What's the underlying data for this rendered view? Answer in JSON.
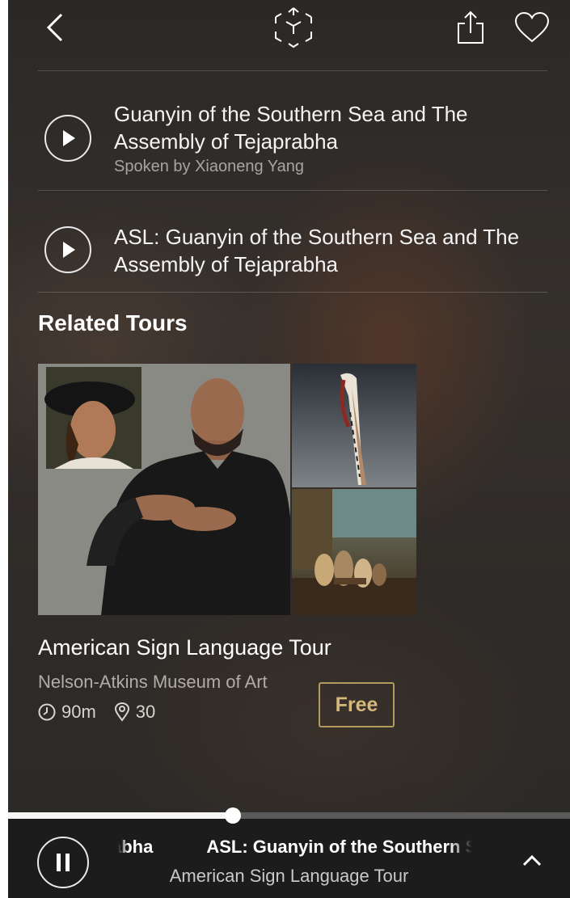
{
  "topbar": {
    "back_icon": "chevron-left-icon",
    "ar_icon": "ar-cube-icon",
    "share_icon": "share-icon",
    "favorite_icon": "heart-icon"
  },
  "tracks": [
    {
      "title": "Guanyin of the Southern Sea and The Assembly of Tejaprabha",
      "subtitle": "Spoken by Xiaoneng Yang",
      "icon": "play-icon"
    },
    {
      "title": "ASL: Guanyin of the Southern Sea and The Assembly of Tejaprabha",
      "icon": "play-icon"
    }
  ],
  "related": {
    "heading": "Related Tours",
    "tour": {
      "title": "American Sign Language Tour",
      "museum": "Nelson-Atkins Museum of Art",
      "duration": "90m",
      "stops": "30",
      "price": "Free",
      "duration_icon": "clock-icon",
      "stops_icon": "location-pin-icon"
    }
  },
  "player": {
    "progress_fraction": 0.4,
    "marquee_prev": "abha",
    "marquee_current": "ASL: Guanyin of the Southern Sea and The Assembly of Tejaprabha",
    "subtitle": "American Sign Language Tour",
    "pause_icon": "pause-icon",
    "expand_icon": "chevron-up-icon"
  },
  "colors": {
    "accent_gold": "#b39a5e",
    "background": "#2f2b28",
    "player_bar": "#1c1c1c"
  }
}
